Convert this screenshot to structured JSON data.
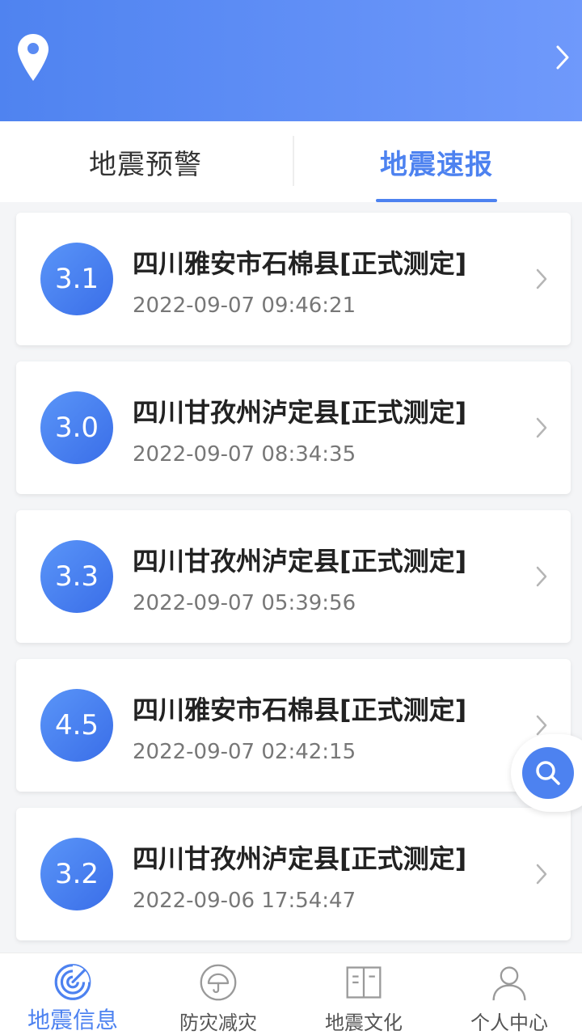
{
  "tabs": [
    {
      "label": "地震预警",
      "active": false
    },
    {
      "label": "地震速报",
      "active": true
    }
  ],
  "quakes": [
    {
      "magnitude": "3.1",
      "place": "四川雅安市石棉县[正式测定]",
      "time": "2022-09-07 09:46:21"
    },
    {
      "magnitude": "3.0",
      "place": "四川甘孜州泸定县[正式测定]",
      "time": "2022-09-07 08:34:35"
    },
    {
      "magnitude": "3.3",
      "place": "四川甘孜州泸定县[正式测定]",
      "time": "2022-09-07 05:39:56"
    },
    {
      "magnitude": "4.5",
      "place": "四川雅安市石棉县[正式测定]",
      "time": "2022-09-07 02:42:15"
    },
    {
      "magnitude": "3.2",
      "place": "四川甘孜州泸定县[正式测定]",
      "time": "2022-09-06 17:54:47"
    }
  ],
  "bottom_nav": [
    {
      "label": "地震信息",
      "icon": "radar-icon",
      "active": true
    },
    {
      "label": "防灾减灾",
      "icon": "umbrella-icon",
      "active": false
    },
    {
      "label": "地震文化",
      "icon": "book-icon",
      "active": false
    },
    {
      "label": "个人中心",
      "icon": "user-icon",
      "active": false
    }
  ],
  "colors": {
    "accent": "#4d82f0",
    "header_start": "#4f83f0",
    "header_end": "#6f99fb"
  }
}
